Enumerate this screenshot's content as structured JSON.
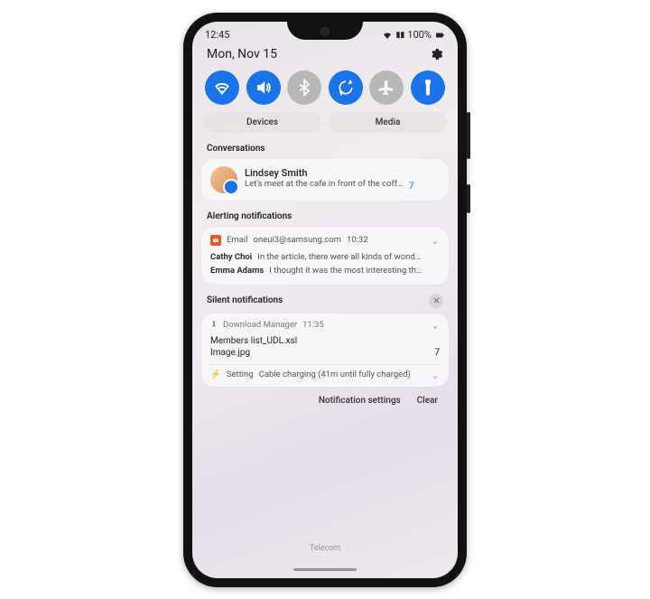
{
  "status": {
    "time": "12:45",
    "battery_pct": "100%"
  },
  "date": "Mon, Nov 15",
  "quick_settings": [
    {
      "name": "wifi",
      "on": true
    },
    {
      "name": "sound",
      "on": true
    },
    {
      "name": "bluetooth",
      "on": false
    },
    {
      "name": "rotate",
      "on": true
    },
    {
      "name": "airplane",
      "on": false
    },
    {
      "name": "flashlight",
      "on": true
    }
  ],
  "tabs": {
    "devices": "Devices",
    "media": "Media"
  },
  "sections": {
    "conversations": "Conversations",
    "alerting": "Alerting notifications",
    "silent": "Silent notifications"
  },
  "conversation": {
    "name": "Lindsey Smith",
    "message": "Let's meet at the cafe in front of the coff…",
    "count": "7"
  },
  "alerting": {
    "app": "Email",
    "from": "oneui3@samsung.com",
    "time": "10:32",
    "items": [
      {
        "who": "Cathy Choi",
        "what": "In the article, there were all kinds of wond…"
      },
      {
        "who": "Emma Adams",
        "what": "I thought it was the most interesting th…"
      }
    ]
  },
  "silent": {
    "dm_app": "Download Manager",
    "dm_time": "11:35",
    "files": [
      {
        "name": "Members list_UDL.xsl",
        "count": ""
      },
      {
        "name": "Image.jpg",
        "count": "7"
      }
    ],
    "setting_app": "Setting",
    "setting_text": "Cable charging (41m until fully charged)"
  },
  "footer": {
    "settings": "Notification settings",
    "clear": "Clear"
  },
  "carrier": "Telecom"
}
